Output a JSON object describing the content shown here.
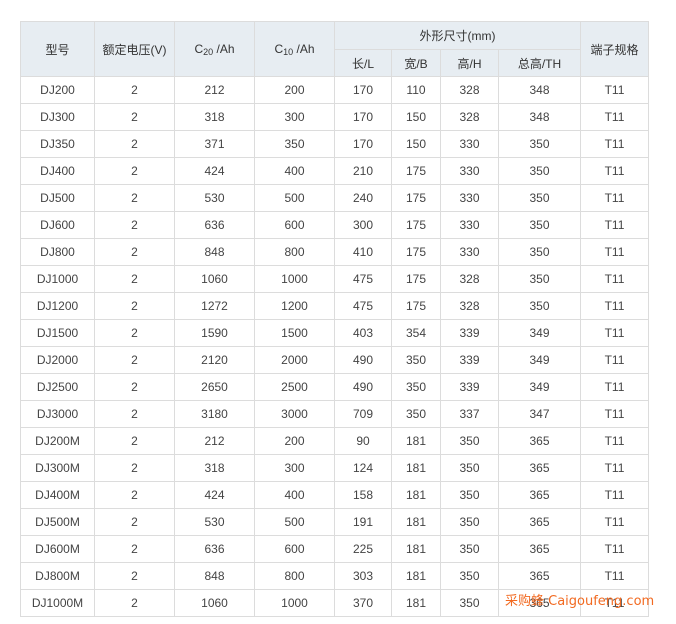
{
  "headers": {
    "model": "型号",
    "voltage": "额定电压(V)",
    "c20": "C20 /Ah",
    "c20_main": "C",
    "c20_sub": "20",
    "c20_unit": " /Ah",
    "c10": "C10 /Ah",
    "c10_main": "C",
    "c10_sub": "10",
    "c10_unit": " /Ah",
    "dimensions": "外形尺寸(mm)",
    "length": "长/L",
    "width": "宽/B",
    "height": "高/H",
    "total_height": "总高/TH",
    "terminal": "端子规格"
  },
  "rows": [
    {
      "model": "DJ200",
      "voltage": "2",
      "c20": "212",
      "c10": "200",
      "length": "170",
      "width": "110",
      "height": "328",
      "total_height": "348",
      "terminal": "T11"
    },
    {
      "model": "DJ300",
      "voltage": "2",
      "c20": "318",
      "c10": "300",
      "length": "170",
      "width": "150",
      "height": "328",
      "total_height": "348",
      "terminal": "T11"
    },
    {
      "model": "DJ350",
      "voltage": "2",
      "c20": "371",
      "c10": "350",
      "length": "170",
      "width": "150",
      "height": "330",
      "total_height": "350",
      "terminal": "T11"
    },
    {
      "model": "DJ400",
      "voltage": "2",
      "c20": "424",
      "c10": "400",
      "length": "210",
      "width": "175",
      "height": "330",
      "total_height": "350",
      "terminal": "T11"
    },
    {
      "model": "DJ500",
      "voltage": "2",
      "c20": "530",
      "c10": "500",
      "length": "240",
      "width": "175",
      "height": "330",
      "total_height": "350",
      "terminal": "T11"
    },
    {
      "model": "DJ600",
      "voltage": "2",
      "c20": "636",
      "c10": "600",
      "length": "300",
      "width": "175",
      "height": "330",
      "total_height": "350",
      "terminal": "T11"
    },
    {
      "model": "DJ800",
      "voltage": "2",
      "c20": "848",
      "c10": "800",
      "length": "410",
      "width": "175",
      "height": "330",
      "total_height": "350",
      "terminal": "T11"
    },
    {
      "model": "DJ1000",
      "voltage": "2",
      "c20": "1060",
      "c10": "1000",
      "length": "475",
      "width": "175",
      "height": "328",
      "total_height": "350",
      "terminal": "T11"
    },
    {
      "model": "DJ1200",
      "voltage": "2",
      "c20": "1272",
      "c10": "1200",
      "length": "475",
      "width": "175",
      "height": "328",
      "total_height": "350",
      "terminal": "T11"
    },
    {
      "model": "DJ1500",
      "voltage": "2",
      "c20": "1590",
      "c10": "1500",
      "length": "403",
      "width": "354",
      "height": "339",
      "total_height": "349",
      "terminal": "T11"
    },
    {
      "model": "DJ2000",
      "voltage": "2",
      "c20": "2120",
      "c10": "2000",
      "length": "490",
      "width": "350",
      "height": "339",
      "total_height": "349",
      "terminal": "T11"
    },
    {
      "model": "DJ2500",
      "voltage": "2",
      "c20": "2650",
      "c10": "2500",
      "length": "490",
      "width": "350",
      "height": "339",
      "total_height": "349",
      "terminal": "T11"
    },
    {
      "model": "DJ3000",
      "voltage": "2",
      "c20": "3180",
      "c10": "3000",
      "length": "709",
      "width": "350",
      "height": "337",
      "total_height": "347",
      "terminal": "T11"
    },
    {
      "model": "DJ200M",
      "voltage": "2",
      "c20": "212",
      "c10": "200",
      "length": "90",
      "width": "181",
      "height": "350",
      "total_height": "365",
      "terminal": "T11"
    },
    {
      "model": "DJ300M",
      "voltage": "2",
      "c20": "318",
      "c10": "300",
      "length": "124",
      "width": "181",
      "height": "350",
      "total_height": "365",
      "terminal": "T11"
    },
    {
      "model": "DJ400M",
      "voltage": "2",
      "c20": "424",
      "c10": "400",
      "length": "158",
      "width": "181",
      "height": "350",
      "total_height": "365",
      "terminal": "T11"
    },
    {
      "model": "DJ500M",
      "voltage": "2",
      "c20": "530",
      "c10": "500",
      "length": "191",
      "width": "181",
      "height": "350",
      "total_height": "365",
      "terminal": "T11"
    },
    {
      "model": "DJ600M",
      "voltage": "2",
      "c20": "636",
      "c10": "600",
      "length": "225",
      "width": "181",
      "height": "350",
      "total_height": "365",
      "terminal": "T11"
    },
    {
      "model": "DJ800M",
      "voltage": "2",
      "c20": "848",
      "c10": "800",
      "length": "303",
      "width": "181",
      "height": "350",
      "total_height": "365",
      "terminal": "T11"
    },
    {
      "model": "DJ1000M",
      "voltage": "2",
      "c20": "1060",
      "c10": "1000",
      "length": "370",
      "width": "181",
      "height": "350",
      "total_height": "365",
      "terminal": "T11"
    }
  ],
  "watermark": "采购蜂 Caigoufeng.com",
  "colors": {
    "header_bg": "#e7edf2",
    "border": "#dcdcdc",
    "text": "#444444",
    "watermark": "#f26a21"
  }
}
